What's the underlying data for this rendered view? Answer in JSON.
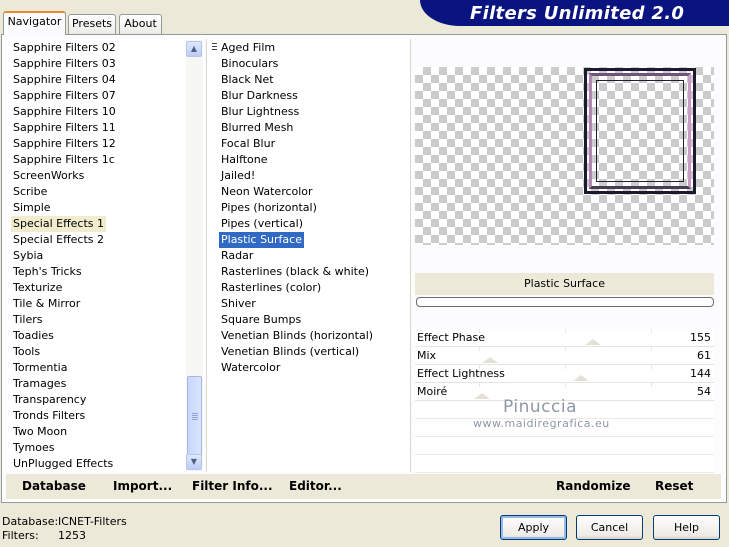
{
  "tabs": [
    "Navigator",
    "Presets",
    "About"
  ],
  "app_title": "Filters Unlimited 2.0",
  "categories": [
    "Sapphire Filters 02",
    "Sapphire Filters 03",
    "Sapphire Filters 04",
    "Sapphire Filters 07",
    "Sapphire Filters 10",
    "Sapphire Filters 11",
    "Sapphire Filters 12",
    "Sapphire Filters 1c",
    "ScreenWorks",
    "Scribe",
    "Simple",
    "Special Effects 1",
    "Special Effects 2",
    "Sybia",
    "Teph's Tricks",
    "Texturize",
    "Tile & Mirror",
    "Tilers",
    "Toadies",
    "Tools",
    "Tormentia",
    "Tramages",
    "Transparency",
    "Tronds Filters",
    "Two Moon",
    "Tymoes",
    "UnPlugged Effects"
  ],
  "selected_category": "Special Effects 1",
  "filters": [
    "Aged Film",
    "Binoculars",
    "Black Net",
    "Blur Darkness",
    "Blur Lightness",
    "Blurred Mesh",
    "Focal Blur",
    "Halftone",
    "Jailed!",
    "Neon Watercolor",
    "Pipes (horizontal)",
    "Pipes (vertical)",
    "Plastic Surface",
    "Radar",
    "Rasterlines (black & white)",
    "Rasterlines (color)",
    "Shiver",
    "Square Bumps",
    "Venetian Blinds (horizontal)",
    "Venetian Blinds (vertical)",
    "Watercolor"
  ],
  "selected_filter": "Plastic Surface",
  "current_filter_name": "Plastic Surface",
  "sliders": [
    {
      "label": "Effect Phase",
      "value": "155",
      "level": 155
    },
    {
      "label": "Mix",
      "value": "61",
      "level": 61
    },
    {
      "label": "Effect Lightness",
      "value": "144",
      "level": 144
    },
    {
      "label": "Moiré",
      "value": "54",
      "level": 54
    }
  ],
  "watermark": {
    "name": "Pinuccia",
    "site": "www.maidiregrafica.eu"
  },
  "toolbar": {
    "database": "Database",
    "import": "Import...",
    "filter_info": "Filter Info...",
    "editor": "Editor...",
    "randomize": "Randomize",
    "reset": "Reset"
  },
  "footer": {
    "database_label": "Database:",
    "database_value": "ICNET-Filters",
    "filters_label": "Filters:",
    "filters_value": "1253",
    "apply": "Apply",
    "cancel": "Cancel",
    "help": "Help"
  }
}
